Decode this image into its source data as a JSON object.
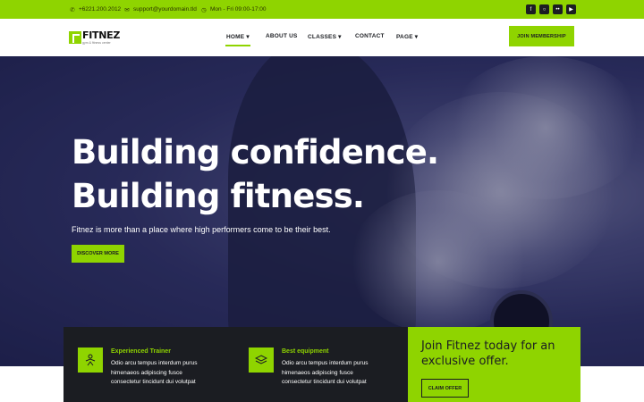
{
  "topbar": {
    "phone": "+6221.200.2012",
    "email": "support@yourdomain.tld",
    "hours": "Mon - Fri 09:00-17:00",
    "social": [
      "facebook-icon",
      "instagram-icon",
      "flickr-icon",
      "youtube-icon"
    ]
  },
  "brand": {
    "name": "FITNEZ",
    "tagline": "gym & fitness center",
    "accent": "#8fd400",
    "dark": "#1b1d22"
  },
  "nav": {
    "items": [
      {
        "label": "HOME",
        "dropdown": true,
        "active": true
      },
      {
        "label": "ABOUT US",
        "dropdown": false
      },
      {
        "label": "CLASSES",
        "dropdown": true
      },
      {
        "label": "CONTACT",
        "dropdown": false
      },
      {
        "label": "PAGE",
        "dropdown": true
      }
    ],
    "cta": "JOIN MEMBERSHIP"
  },
  "hero": {
    "title_line1": "Building confidence.",
    "title_line2": "Building fitness.",
    "subtitle": "Fitnez is more than a place where high performers come to be their best.",
    "button": "DISCOVER MORE"
  },
  "features": [
    {
      "title": "Experienced Trainer",
      "lines": [
        "Odio arcu tempus interdum purus",
        "himenaeos adipiscing fusce",
        "consectetur tincidunt dui volutpat"
      ]
    },
    {
      "title": "Best equipment",
      "lines": [
        "Odio arcu tempus interdum purus",
        "himenaeos adipiscing fusce",
        "consectetur tincidunt dui volutpat"
      ]
    }
  ],
  "offer": {
    "title": "Join Fitnez today for an exclusive offer.",
    "button": "CLAIM OFFER"
  }
}
